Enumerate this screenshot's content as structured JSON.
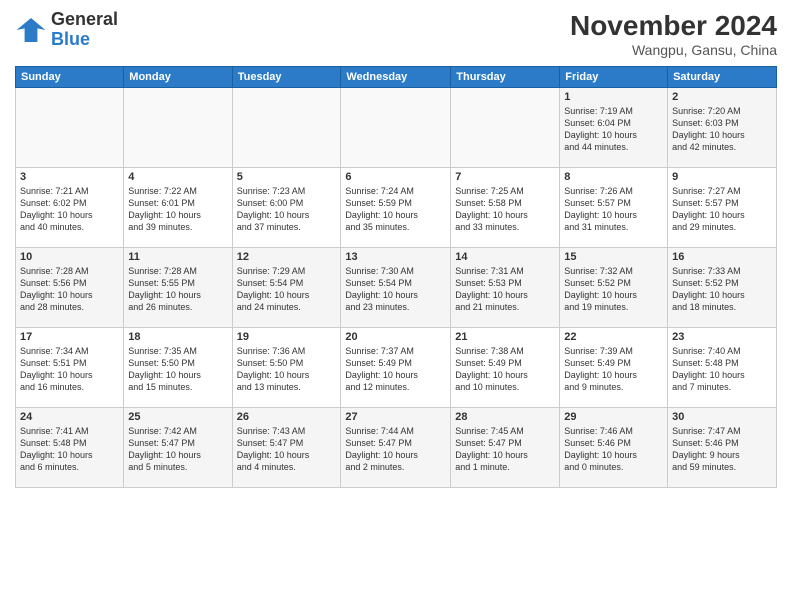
{
  "header": {
    "logo_general": "General",
    "logo_blue": "Blue",
    "month_title": "November 2024",
    "location": "Wangpu, Gansu, China"
  },
  "weekdays": [
    "Sunday",
    "Monday",
    "Tuesday",
    "Wednesday",
    "Thursday",
    "Friday",
    "Saturday"
  ],
  "weeks": [
    [
      {
        "day": "",
        "info": ""
      },
      {
        "day": "",
        "info": ""
      },
      {
        "day": "",
        "info": ""
      },
      {
        "day": "",
        "info": ""
      },
      {
        "day": "",
        "info": ""
      },
      {
        "day": "1",
        "info": "Sunrise: 7:19 AM\nSunset: 6:04 PM\nDaylight: 10 hours\nand 44 minutes."
      },
      {
        "day": "2",
        "info": "Sunrise: 7:20 AM\nSunset: 6:03 PM\nDaylight: 10 hours\nand 42 minutes."
      }
    ],
    [
      {
        "day": "3",
        "info": "Sunrise: 7:21 AM\nSunset: 6:02 PM\nDaylight: 10 hours\nand 40 minutes."
      },
      {
        "day": "4",
        "info": "Sunrise: 7:22 AM\nSunset: 6:01 PM\nDaylight: 10 hours\nand 39 minutes."
      },
      {
        "day": "5",
        "info": "Sunrise: 7:23 AM\nSunset: 6:00 PM\nDaylight: 10 hours\nand 37 minutes."
      },
      {
        "day": "6",
        "info": "Sunrise: 7:24 AM\nSunset: 5:59 PM\nDaylight: 10 hours\nand 35 minutes."
      },
      {
        "day": "7",
        "info": "Sunrise: 7:25 AM\nSunset: 5:58 PM\nDaylight: 10 hours\nand 33 minutes."
      },
      {
        "day": "8",
        "info": "Sunrise: 7:26 AM\nSunset: 5:57 PM\nDaylight: 10 hours\nand 31 minutes."
      },
      {
        "day": "9",
        "info": "Sunrise: 7:27 AM\nSunset: 5:57 PM\nDaylight: 10 hours\nand 29 minutes."
      }
    ],
    [
      {
        "day": "10",
        "info": "Sunrise: 7:28 AM\nSunset: 5:56 PM\nDaylight: 10 hours\nand 28 minutes."
      },
      {
        "day": "11",
        "info": "Sunrise: 7:28 AM\nSunset: 5:55 PM\nDaylight: 10 hours\nand 26 minutes."
      },
      {
        "day": "12",
        "info": "Sunrise: 7:29 AM\nSunset: 5:54 PM\nDaylight: 10 hours\nand 24 minutes."
      },
      {
        "day": "13",
        "info": "Sunrise: 7:30 AM\nSunset: 5:54 PM\nDaylight: 10 hours\nand 23 minutes."
      },
      {
        "day": "14",
        "info": "Sunrise: 7:31 AM\nSunset: 5:53 PM\nDaylight: 10 hours\nand 21 minutes."
      },
      {
        "day": "15",
        "info": "Sunrise: 7:32 AM\nSunset: 5:52 PM\nDaylight: 10 hours\nand 19 minutes."
      },
      {
        "day": "16",
        "info": "Sunrise: 7:33 AM\nSunset: 5:52 PM\nDaylight: 10 hours\nand 18 minutes."
      }
    ],
    [
      {
        "day": "17",
        "info": "Sunrise: 7:34 AM\nSunset: 5:51 PM\nDaylight: 10 hours\nand 16 minutes."
      },
      {
        "day": "18",
        "info": "Sunrise: 7:35 AM\nSunset: 5:50 PM\nDaylight: 10 hours\nand 15 minutes."
      },
      {
        "day": "19",
        "info": "Sunrise: 7:36 AM\nSunset: 5:50 PM\nDaylight: 10 hours\nand 13 minutes."
      },
      {
        "day": "20",
        "info": "Sunrise: 7:37 AM\nSunset: 5:49 PM\nDaylight: 10 hours\nand 12 minutes."
      },
      {
        "day": "21",
        "info": "Sunrise: 7:38 AM\nSunset: 5:49 PM\nDaylight: 10 hours\nand 10 minutes."
      },
      {
        "day": "22",
        "info": "Sunrise: 7:39 AM\nSunset: 5:49 PM\nDaylight: 10 hours\nand 9 minutes."
      },
      {
        "day": "23",
        "info": "Sunrise: 7:40 AM\nSunset: 5:48 PM\nDaylight: 10 hours\nand 7 minutes."
      }
    ],
    [
      {
        "day": "24",
        "info": "Sunrise: 7:41 AM\nSunset: 5:48 PM\nDaylight: 10 hours\nand 6 minutes."
      },
      {
        "day": "25",
        "info": "Sunrise: 7:42 AM\nSunset: 5:47 PM\nDaylight: 10 hours\nand 5 minutes."
      },
      {
        "day": "26",
        "info": "Sunrise: 7:43 AM\nSunset: 5:47 PM\nDaylight: 10 hours\nand 4 minutes."
      },
      {
        "day": "27",
        "info": "Sunrise: 7:44 AM\nSunset: 5:47 PM\nDaylight: 10 hours\nand 2 minutes."
      },
      {
        "day": "28",
        "info": "Sunrise: 7:45 AM\nSunset: 5:47 PM\nDaylight: 10 hours\nand 1 minute."
      },
      {
        "day": "29",
        "info": "Sunrise: 7:46 AM\nSunset: 5:46 PM\nDaylight: 10 hours\nand 0 minutes."
      },
      {
        "day": "30",
        "info": "Sunrise: 7:47 AM\nSunset: 5:46 PM\nDaylight: 9 hours\nand 59 minutes."
      }
    ]
  ]
}
